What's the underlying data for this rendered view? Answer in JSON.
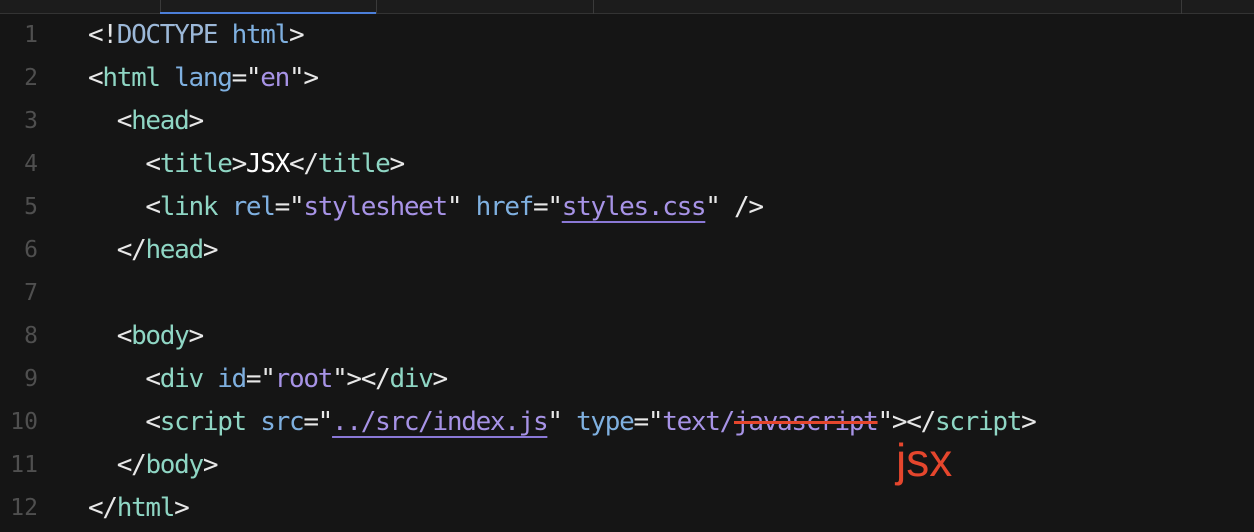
{
  "editor": {
    "lines": [
      {
        "num": "1"
      },
      {
        "num": "2"
      },
      {
        "num": "3"
      },
      {
        "num": "4"
      },
      {
        "num": "5"
      },
      {
        "num": "6"
      },
      {
        "num": "7"
      },
      {
        "num": "8"
      },
      {
        "num": "9"
      },
      {
        "num": "10"
      },
      {
        "num": "11"
      },
      {
        "num": "12"
      }
    ],
    "tokens": {
      "l1_open": "<!",
      "l1_doctype": "DOCTYPE",
      "l1_html": "html",
      "l1_close": ">",
      "l2_lt": "<",
      "l2_tag": "html",
      "l2_attr": "lang",
      "l2_eq": "=\"",
      "l2_val": "en",
      "l2_end": "\">",
      "l3_lt": "<",
      "l3_tag": "head",
      "l3_gt": ">",
      "l4_lt": "<",
      "l4_tag": "title",
      "l4_gt": ">",
      "l4_text": "JSX",
      "l4_lt2": "</",
      "l4_tag2": "title",
      "l4_gt2": ">",
      "l5_lt": "<",
      "l5_tag": "link",
      "l5_attr1": "rel",
      "l5_eq1": "=\"",
      "l5_val1": "stylesheet",
      "l5_q1": "\"",
      "l5_attr2": "href",
      "l5_eq2": "=\"",
      "l5_val2": "styles.css",
      "l5_end": "\" />",
      "l6_lt": "</",
      "l6_tag": "head",
      "l6_gt": ">",
      "l8_lt": "<",
      "l8_tag": "body",
      "l8_gt": ">",
      "l9_lt": "<",
      "l9_tag": "div",
      "l9_attr": "id",
      "l9_eq": "=\"",
      "l9_val": "root",
      "l9_mid": "\"></",
      "l9_tag2": "div",
      "l9_gt": ">",
      "l10_lt": "<",
      "l10_tag": "script",
      "l10_attr1": "src",
      "l10_eq1": "=\"",
      "l10_val1": "../src/index.js",
      "l10_q1": "\"",
      "l10_attr2": "type",
      "l10_eq2": "=\"",
      "l10_val2a": "text/",
      "l10_val2b": "javascript",
      "l10_mid": "\"></",
      "l10_tag2": "script",
      "l10_gt": ">",
      "l11_lt": "</",
      "l11_tag": "body",
      "l11_gt": ">",
      "l12_lt": "</",
      "l12_tag": "html",
      "l12_gt": ">"
    },
    "annotation": "jsx"
  },
  "colors": {
    "background": "#151515",
    "tag": "#8fd6c4",
    "attribute": "#7fb0e0",
    "string": "#a793e6",
    "annotation_red": "#e5462d",
    "line_number": "#4f4f4f"
  }
}
